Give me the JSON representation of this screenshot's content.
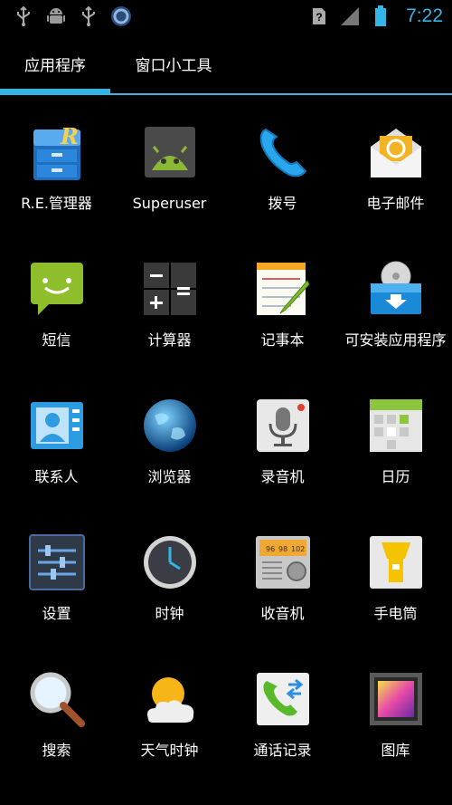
{
  "statusbar": {
    "time": "7:22",
    "icons": [
      "usb-icon",
      "android-debug-icon",
      "usb-icon",
      "sync-icon",
      "sim-unknown-icon",
      "signal-icon",
      "battery-icon"
    ]
  },
  "tabs": {
    "apps": "应用程序",
    "widgets": "窗口小工具"
  },
  "apps": [
    {
      "label": "R.E.管理器",
      "icon": "re-explorer-icon"
    },
    {
      "label": "Superuser",
      "icon": "superuser-android-icon"
    },
    {
      "label": "拨号",
      "icon": "phone-icon"
    },
    {
      "label": "电子邮件",
      "icon": "email-icon"
    },
    {
      "label": "短信",
      "icon": "messaging-icon"
    },
    {
      "label": "计算器",
      "icon": "calculator-icon"
    },
    {
      "label": "记事本",
      "icon": "notepad-icon"
    },
    {
      "label": "可安装应用程序",
      "icon": "installer-icon"
    },
    {
      "label": "联系人",
      "icon": "contacts-icon"
    },
    {
      "label": "浏览器",
      "icon": "browser-globe-icon"
    },
    {
      "label": "录音机",
      "icon": "recorder-microphone-icon"
    },
    {
      "label": "日历",
      "icon": "calendar-icon"
    },
    {
      "label": "设置",
      "icon": "settings-sliders-icon"
    },
    {
      "label": "时钟",
      "icon": "clock-icon"
    },
    {
      "label": "收音机",
      "icon": "radio-icon"
    },
    {
      "label": "手电筒",
      "icon": "flashlight-icon"
    },
    {
      "label": "搜索",
      "icon": "search-magnifier-icon"
    },
    {
      "label": "天气时钟",
      "icon": "weather-icon"
    },
    {
      "label": "通话记录",
      "icon": "call-log-icon"
    },
    {
      "label": "图库",
      "icon": "gallery-icon"
    }
  ]
}
